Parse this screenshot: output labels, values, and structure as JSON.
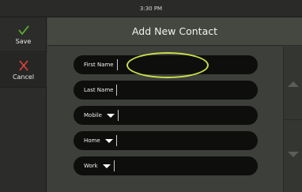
{
  "status_bar": {
    "time": "3:30 PM"
  },
  "sidebar": {
    "save_label": "Save",
    "cancel_label": "Cancel"
  },
  "header": {
    "title": "Add New Contact"
  },
  "form": {
    "fields": [
      {
        "label": "First Name",
        "value": "",
        "has_dropdown": false
      },
      {
        "label": "Last Name",
        "value": "",
        "has_dropdown": false
      },
      {
        "label": "Mobile",
        "value": "",
        "has_dropdown": true
      },
      {
        "label": "Home",
        "value": "",
        "has_dropdown": true
      },
      {
        "label": "Work",
        "value": "",
        "has_dropdown": true
      }
    ]
  },
  "colors": {
    "save_check": "#5fb832",
    "cancel_x": "#e2403a",
    "highlight": "#c9de4a"
  }
}
